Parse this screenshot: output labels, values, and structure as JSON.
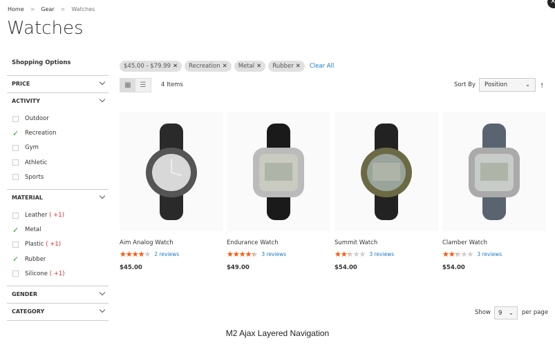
{
  "breadcrumb": [
    "Home",
    "Gear",
    "Watches"
  ],
  "page_title": "Watches",
  "sidebar": {
    "heading": "Shopping Options",
    "sections": [
      {
        "title": "PRICE"
      },
      {
        "title": "ACTIVITY",
        "options": [
          {
            "label": "Outdoor",
            "checked": false
          },
          {
            "label": "Recreation",
            "checked": true
          },
          {
            "label": "Gym",
            "checked": false
          },
          {
            "label": "Athletic",
            "checked": false
          },
          {
            "label": "Sports",
            "checked": false
          }
        ]
      },
      {
        "title": "MATERIAL",
        "options": [
          {
            "label": "Leather",
            "count": "( +1)",
            "checked": false
          },
          {
            "label": "Metal",
            "checked": true
          },
          {
            "label": "Plastic",
            "count": "( +1)",
            "checked": false
          },
          {
            "label": "Rubber",
            "checked": true
          },
          {
            "label": "Silicone",
            "count": "( +1)",
            "checked": false
          }
        ]
      },
      {
        "title": "GENDER"
      },
      {
        "title": "CATEGORY"
      }
    ]
  },
  "filters": {
    "chips": [
      "$45.00 - $79.99",
      "Recreation",
      "Metal",
      "Rubber"
    ],
    "clear_all": "Clear All"
  },
  "toolbar": {
    "items_count": "4 Items",
    "sort_label": "Sort By",
    "sort_value": "Position",
    "show_label": "Show",
    "limit_value": "9",
    "per_page": "per page"
  },
  "products": [
    {
      "name": "Aim Analog Watch",
      "rating_percent": 80,
      "reviews": "2 reviews",
      "price": "$45.00"
    },
    {
      "name": "Endurance Watch",
      "rating_percent": 87,
      "reviews": "3 reviews",
      "price": "$49.00"
    },
    {
      "name": "Summit Watch",
      "rating_percent": 47,
      "reviews": "3 reviews",
      "price": "$54.00"
    },
    {
      "name": "Clamber Watch",
      "rating_percent": 47,
      "reviews": "3 reviews",
      "price": "$54.00"
    }
  ],
  "footer_caption": "M2 Ajax Layered Navigation",
  "colors": {
    "star": "#ff5501",
    "link": "#1979c3",
    "check": "#2a9d2a",
    "count": "#e02b27"
  }
}
